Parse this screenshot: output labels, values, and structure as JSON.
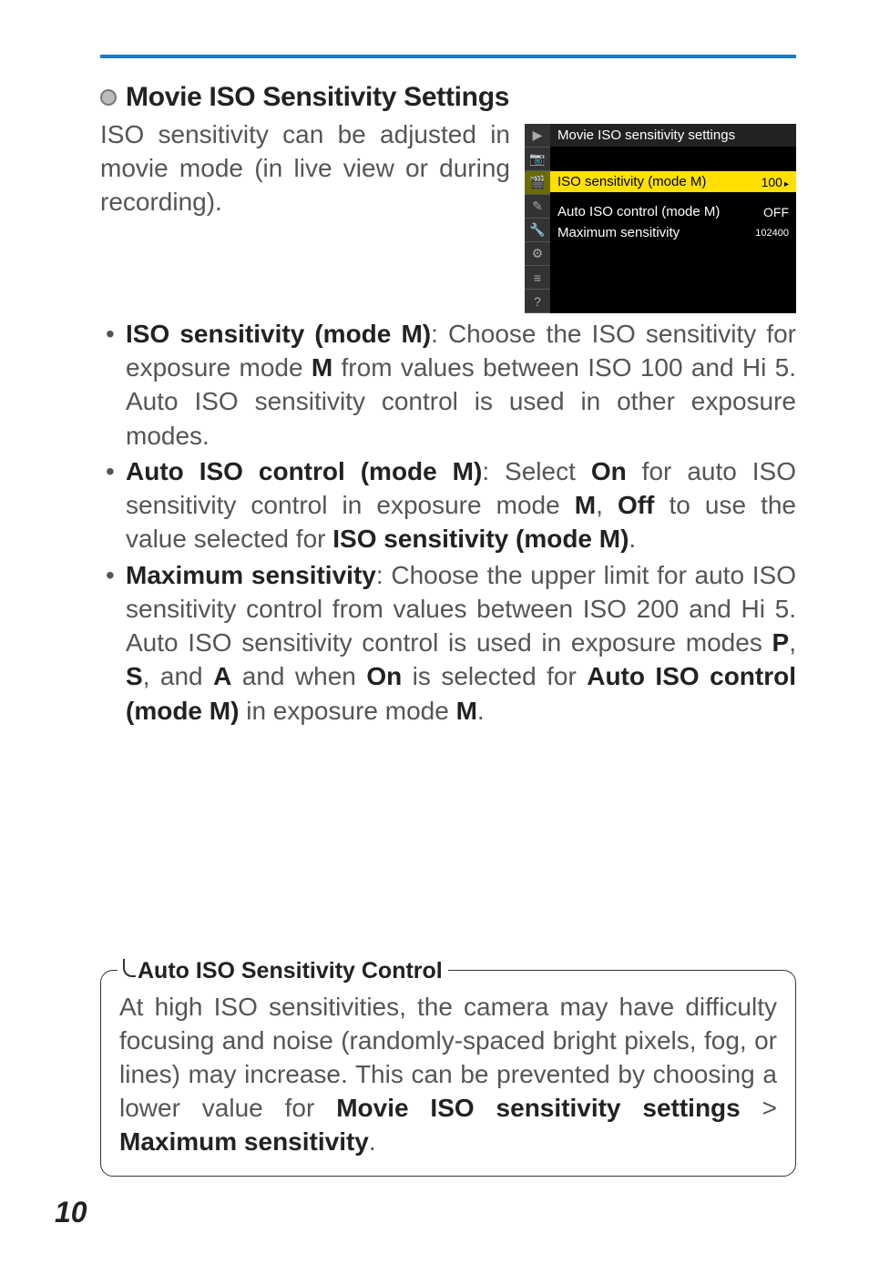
{
  "section": {
    "title": "Movie ISO Sensitivity Settings",
    "intro": "ISO sensitivity can be adjusted in movie mode (in live view or during recording)."
  },
  "screen": {
    "title": "Movie ISO sensitivity settings",
    "rows": [
      {
        "label": "ISO sensitivity (mode M)",
        "value": "100",
        "selected": true,
        "arrow": "▸"
      },
      {
        "label": "Auto ISO control (mode M)",
        "value": "OFF",
        "selected": false
      },
      {
        "label": "Maximum sensitivity",
        "value": "102400",
        "selected": false,
        "small": true
      }
    ],
    "tabs": [
      "▶",
      "📷",
      "🎬",
      "✎",
      "🔧",
      "⚙",
      "≡",
      "?"
    ]
  },
  "bullets": {
    "b1_lead": "ISO sensitivity (mode M)",
    "b1_body_a": ": Choose the ISO sensitivity for exposure mode ",
    "b1_M": "M",
    "b1_body_b": " from values between ISO 100 and Hi 5. Auto ISO sensitivity control is used in other exposure modes.",
    "b2_lead": "Auto ISO control (mode M)",
    "b2_a": ": Select ",
    "b2_on": "On",
    "b2_b": " for auto ISO sensitivity control in exposure mode ",
    "b2_M": "M",
    "b2_c": ", ",
    "b2_off": "Off",
    "b2_d": " to use the value selected for ",
    "b2_iso": "ISO sensitivity (mode M)",
    "b2_e": ".",
    "b3_lead": "Maximum sensitivity",
    "b3_a": ": Choose the upper limit for auto ISO sensitivity control from values between ISO 200 and Hi 5. Auto ISO sensitivity control is used in exposure modes ",
    "b3_P": "P",
    "b3_c1": ", ",
    "b3_S": "S",
    "b3_c2": ", and ",
    "b3_A": "A",
    "b3_b": " and when ",
    "b3_on": "On",
    "b3_c": " is selected for ",
    "b3_auto": "Auto ISO control (mode M)",
    "b3_d": " in exposure mode ",
    "b3_M": "M",
    "b3_e": "."
  },
  "note": {
    "title": "Auto ISO Sensitivity Control",
    "a": "At high ISO sensitivities, the camera may have difficulty focusing and noise (randomly-spaced bright pixels, fog, or lines) may increase. This can be prevented by choosing a lower value for ",
    "b": "Movie ISO sensitivity settings",
    "gt": " > ",
    "c": "Maximum sensitivity",
    "d": "."
  },
  "page": "10"
}
